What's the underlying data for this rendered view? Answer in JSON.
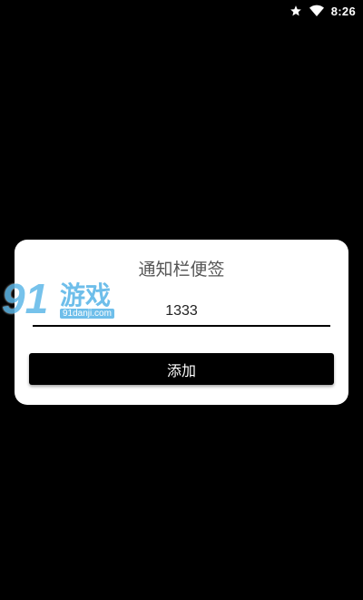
{
  "status_bar": {
    "time": "8:26",
    "icons": [
      "star-icon",
      "wifi-icon"
    ]
  },
  "dialog": {
    "title": "通知栏便签",
    "input": {
      "value": "1333",
      "placeholder": ""
    },
    "add_button_label": "添加"
  },
  "watermark": {
    "number": "91",
    "text": "游戏",
    "site": "91danji.com"
  },
  "colors": {
    "background": "#000000",
    "dialog": "#ffffff",
    "button": "#000000",
    "watermark": "#5fb8e8"
  }
}
